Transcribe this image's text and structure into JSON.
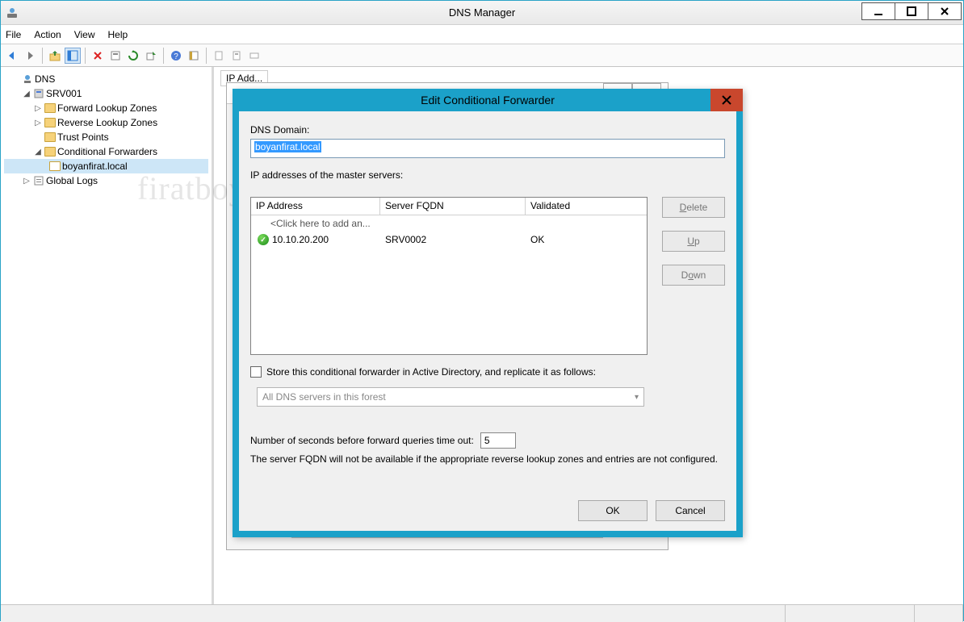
{
  "window": {
    "title": "DNS Manager",
    "menu": {
      "file": "File",
      "action": "Action",
      "view": "View",
      "help": "Help"
    }
  },
  "tree": {
    "root": "DNS",
    "server": "SRV001",
    "flz": "Forward Lookup Zones",
    "rlz": "Reverse Lookup Zones",
    "tp": "Trust Points",
    "cf": "Conditional Forwarders",
    "cf_child": "boyanfirat.local",
    "gl": "Global Logs"
  },
  "dialog": {
    "title": "Edit Conditional Forwarder",
    "dns_domain_label": "DNS Domain:",
    "dns_domain_value": "boyanfirat.local",
    "masters_label": "IP addresses of the master servers:",
    "columns": {
      "ip": "IP Address",
      "fqdn": "Server FQDN",
      "val": "Validated"
    },
    "click_add": "<Click here to add an...",
    "row1": {
      "ip": "10.10.20.200",
      "fqdn": "SRV0002",
      "val": "OK"
    },
    "buttons": {
      "delete": "Delete",
      "up": "Up",
      "down": "Down",
      "ok": "OK",
      "cancel": "Cancel"
    },
    "store_label": "Store this conditional forwarder in Active Directory, and replicate it as follows:",
    "replicate_option": "All DNS servers in this forest",
    "timeout_label": "Number of seconds before forward queries time out:",
    "timeout_value": "5",
    "note": "The server FQDN will not be available if the appropriate reverse lookup zones and entries are not configured."
  },
  "bgdlg": {
    "help": "?",
    "close": "X"
  },
  "watermark": "firatboyan.com"
}
